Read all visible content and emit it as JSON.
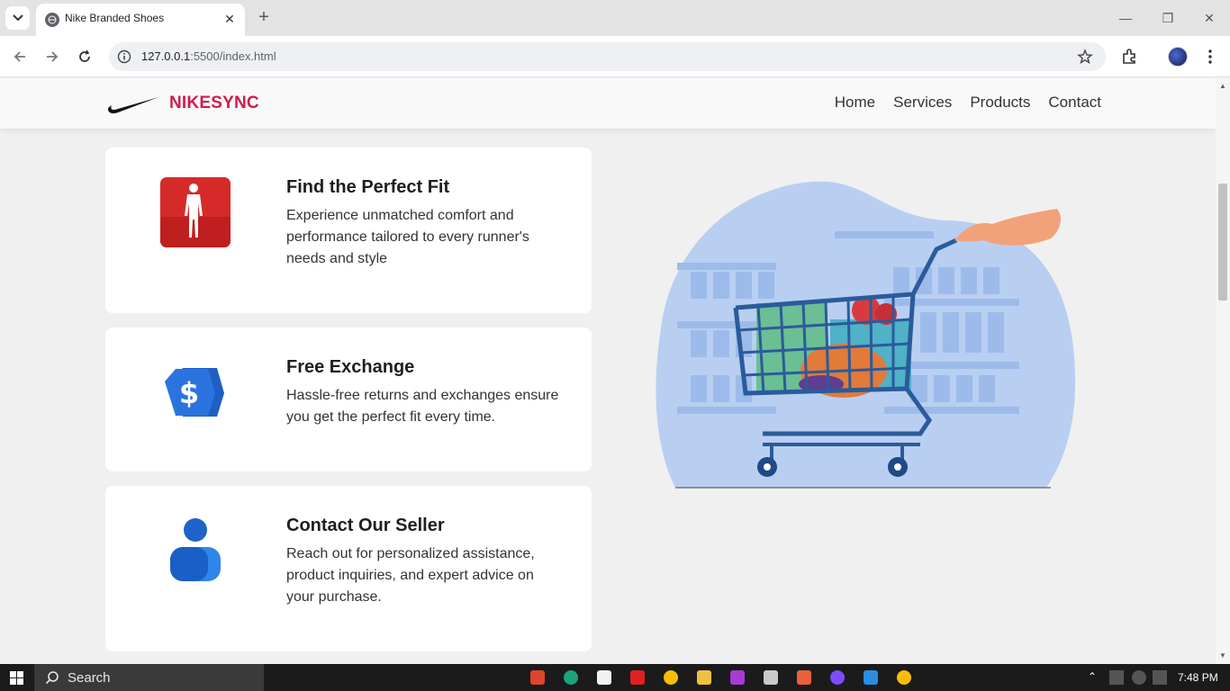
{
  "browser": {
    "tab_title": "Nike Branded Shoes",
    "url_host": "127.0.0.1",
    "url_path": ":5500/index.html"
  },
  "site": {
    "logo_text": "NIKESYNC",
    "nav": [
      "Home",
      "Services",
      "Products",
      "Contact"
    ]
  },
  "cards": [
    {
      "title": "Find the Perfect Fit",
      "text": "Experience unmatched comfort and performance tailored to every runner's needs and style",
      "icon": "body-figure-icon"
    },
    {
      "title": "Free Exchange",
      "text": "Hassle-free returns and exchanges ensure you get the perfect fit every time.",
      "icon": "dollar-tag-icon"
    },
    {
      "title": "Contact Our Seller",
      "text": "Reach out for personalized assistance, product inquiries, and expert advice on your purchase.",
      "icon": "person-icon"
    }
  ],
  "taskbar": {
    "search_label": "Search",
    "time": "7:48 PM"
  },
  "colors": {
    "brand": "#d21b4b",
    "card_bg": "#ffffff",
    "page_bg": "#f0f0f0"
  }
}
